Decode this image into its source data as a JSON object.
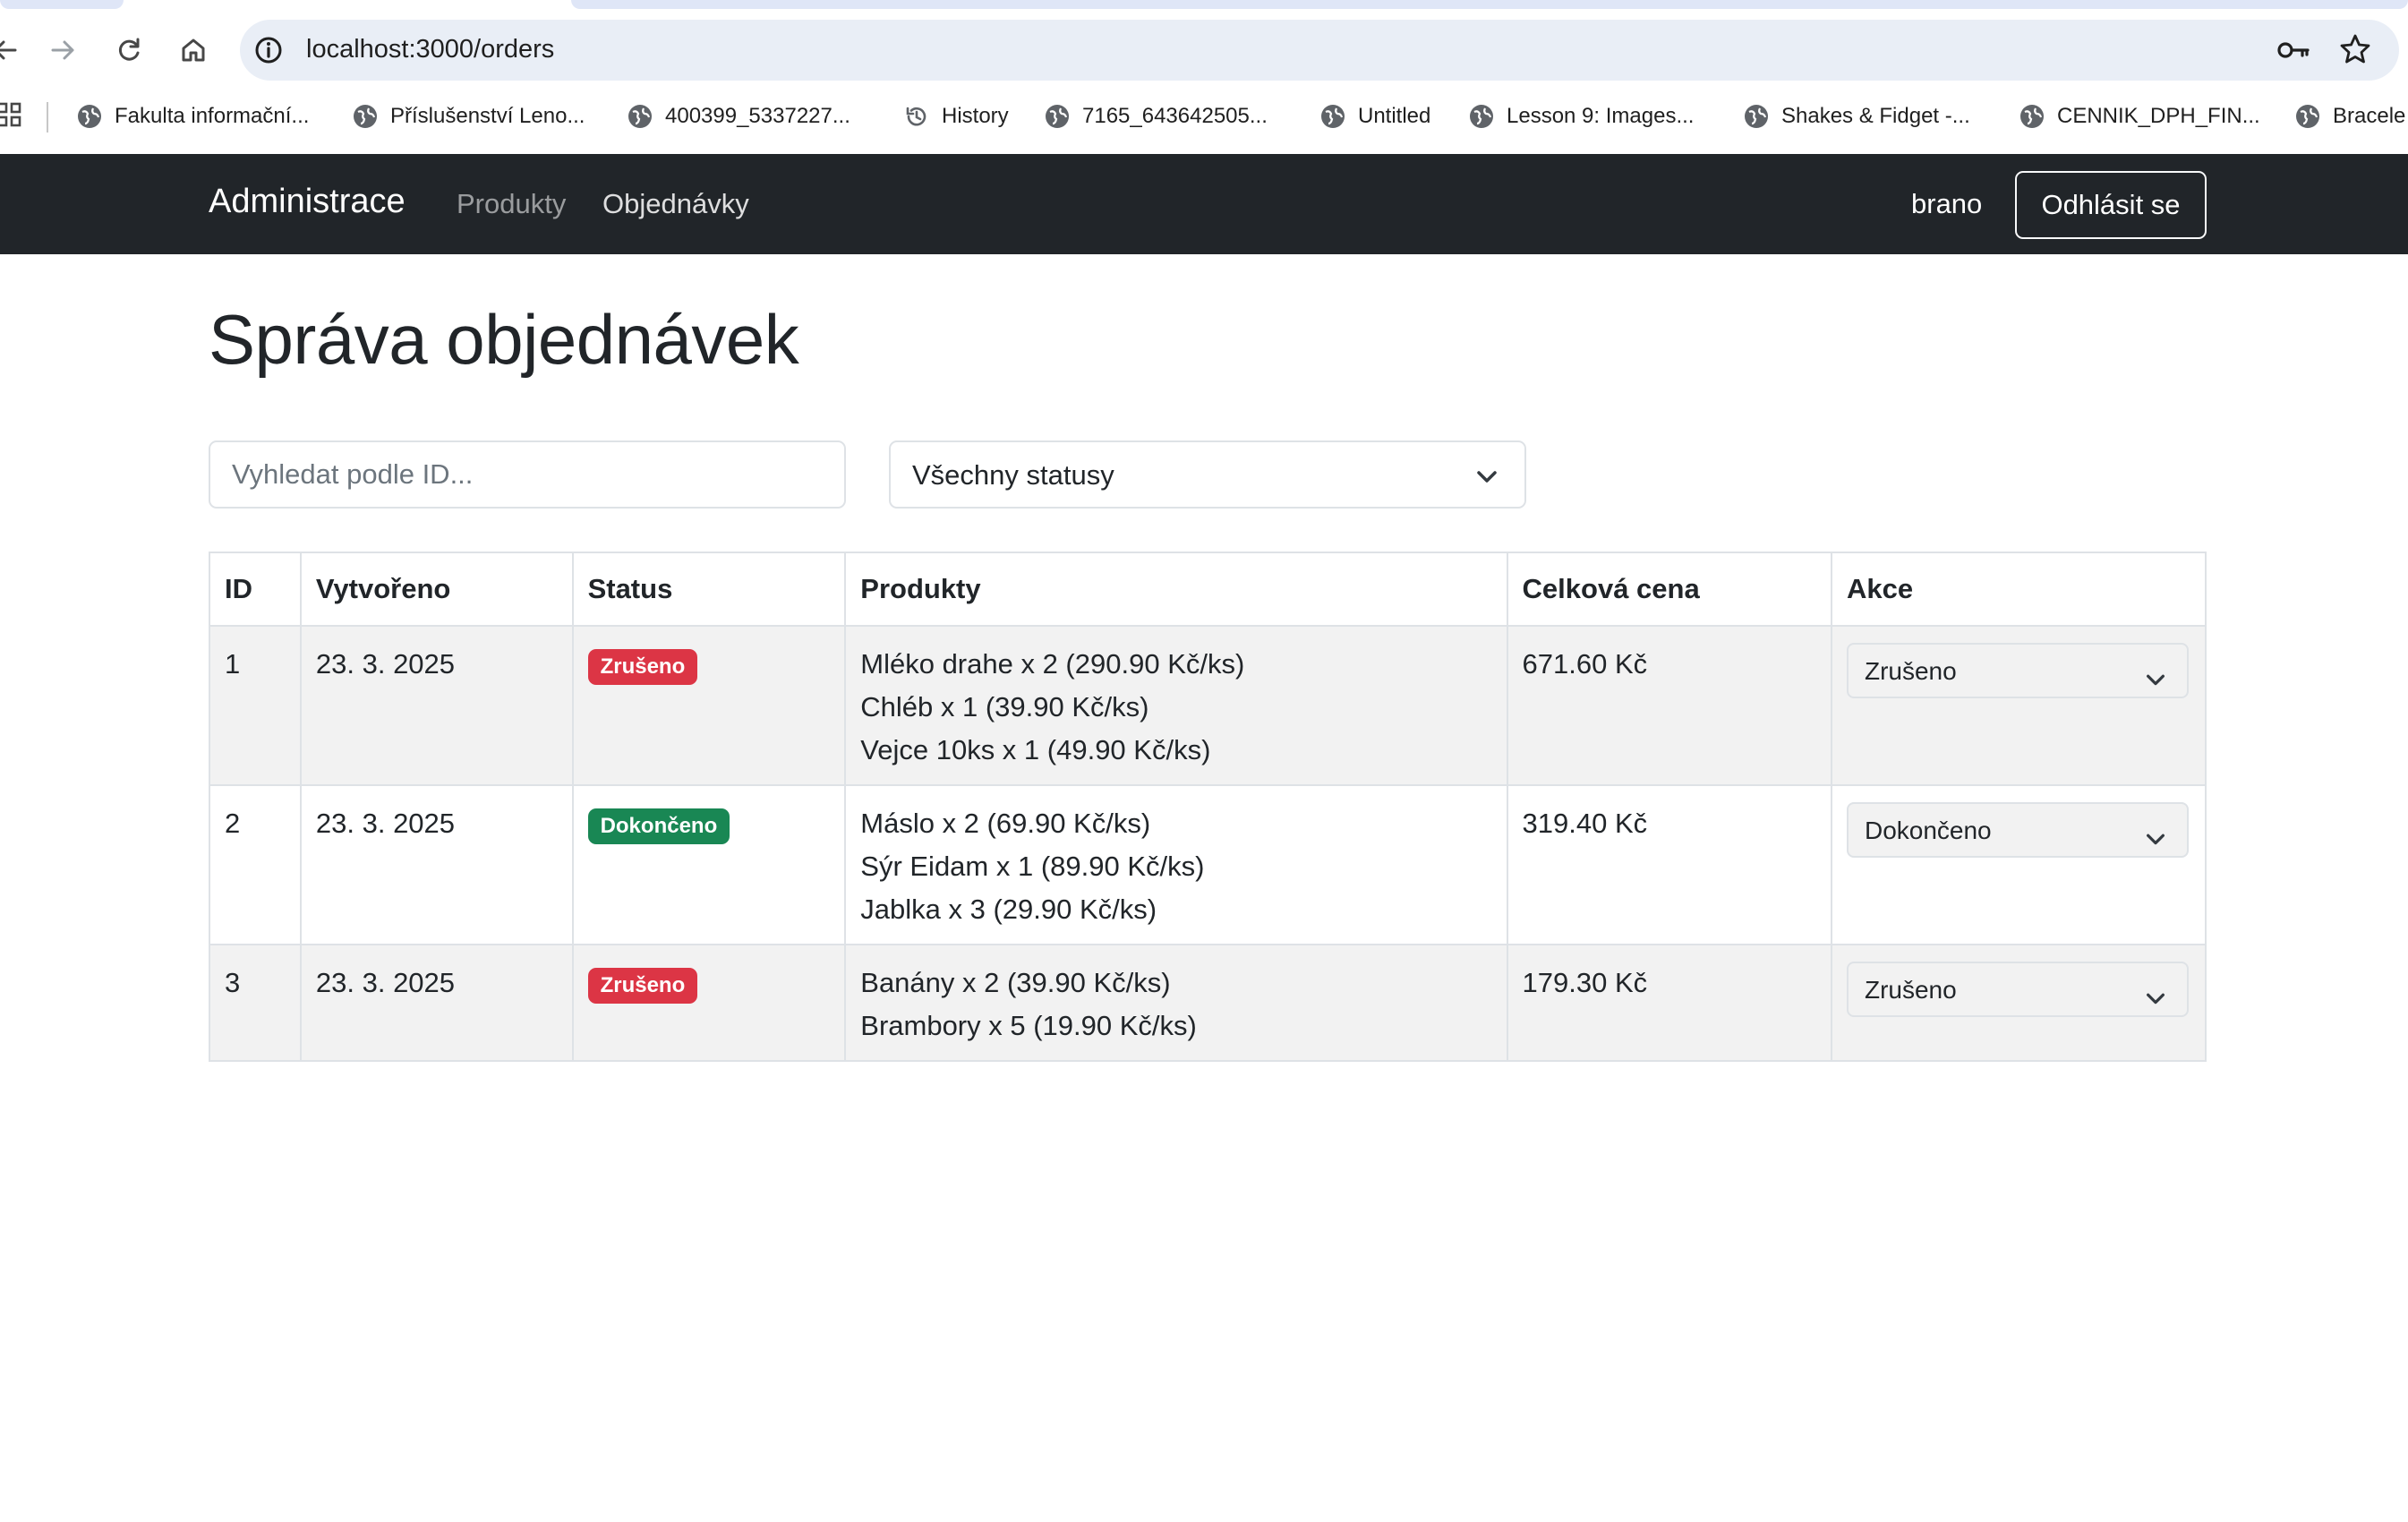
{
  "browser": {
    "url": "localhost:3000/orders",
    "icons": {
      "back": "back-arrow-icon",
      "forward": "forward-arrow-icon",
      "reload": "reload-icon",
      "home": "home-icon",
      "site_info": "info-icon",
      "password": "key-icon",
      "bookmark": "star-icon"
    },
    "bookmarks": [
      {
        "label": "Fakulta informační..."
      },
      {
        "label": "Příslušenství Leno..."
      },
      {
        "label": "400399_5337227..."
      },
      {
        "label": "History"
      },
      {
        "label": "7165_643642505..."
      },
      {
        "label": "Untitled"
      },
      {
        "label": "Lesson 9: Images..."
      },
      {
        "label": "Shakes & Fidget -..."
      },
      {
        "label": "CENNIK_DPH_FIN..."
      },
      {
        "label": "Bracele"
      }
    ]
  },
  "navbar": {
    "brand": "Administrace",
    "links": [
      {
        "label": "Produkty"
      },
      {
        "label": "Objednávky"
      }
    ],
    "username": "brano",
    "logout_label": "Odhlásit se",
    "background": "#212529"
  },
  "page": {
    "title": "Správa objednávek",
    "search_placeholder": "Vyhledat podle ID...",
    "status_filter": "Všechny statusy"
  },
  "table": {
    "headers": {
      "id": "ID",
      "created": "Vytvořeno",
      "status": "Status",
      "products": "Produkty",
      "total": "Celková cena",
      "actions": "Akce"
    },
    "rows": [
      {
        "id": "1",
        "created": "23. 3. 2025",
        "status": "Zrušeno",
        "status_color": "#dc3545",
        "products": [
          "Mléko drahe x 2 (290.90 Kč/ks)",
          "Chléb x 1 (39.90 Kč/ks)",
          "Vejce 10ks x 1 (49.90 Kč/ks)"
        ],
        "total": "671.60 Kč",
        "action_value": "Zrušeno"
      },
      {
        "id": "2",
        "created": "23. 3. 2025",
        "status": "Dokončeno",
        "status_color": "#198754",
        "products": [
          "Máslo x 2 (69.90 Kč/ks)",
          "Sýr Eidam x 1 (89.90 Kč/ks)",
          "Jablka x 3 (29.90 Kč/ks)"
        ],
        "total": "319.40 Kč",
        "action_value": "Dokončeno"
      },
      {
        "id": "3",
        "created": "23. 3. 2025",
        "status": "Zrušeno",
        "status_color": "#dc3545",
        "products": [
          "Banány x 2 (39.90 Kč/ks)",
          "Brambory x 5 (19.90 Kč/ks)"
        ],
        "total": "179.30 Kč",
        "action_value": "Zrušeno"
      }
    ]
  }
}
